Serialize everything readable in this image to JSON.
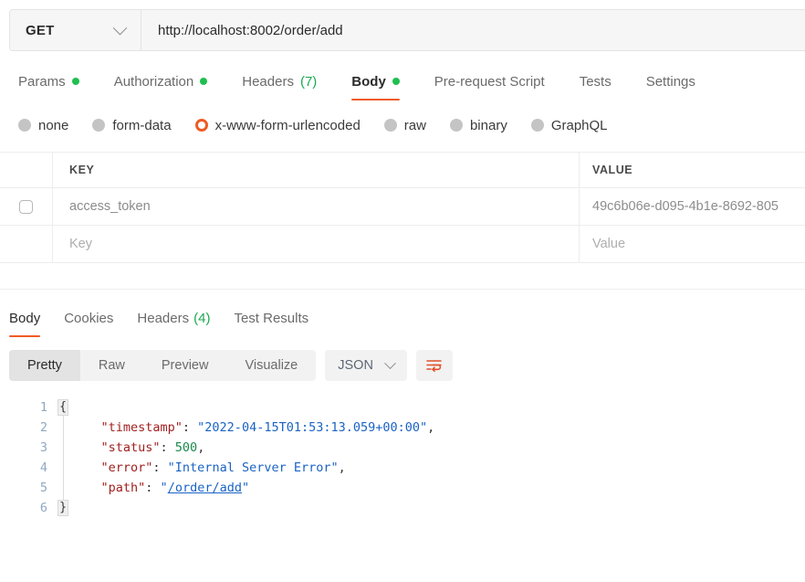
{
  "request": {
    "method": "GET",
    "url": "http://localhost:8002/order/add",
    "tabs": [
      {
        "label": "Params",
        "dot": true,
        "count": "",
        "active": false
      },
      {
        "label": "Authorization",
        "dot": true,
        "count": "",
        "active": false
      },
      {
        "label": "Headers",
        "dot": false,
        "count": "(7)",
        "active": false
      },
      {
        "label": "Body",
        "dot": true,
        "count": "",
        "active": true
      },
      {
        "label": "Pre-request Script",
        "dot": false,
        "count": "",
        "active": false
      },
      {
        "label": "Tests",
        "dot": false,
        "count": "",
        "active": false
      },
      {
        "label": "Settings",
        "dot": false,
        "count": "",
        "active": false
      }
    ],
    "body_types": [
      {
        "label": "none",
        "selected": false
      },
      {
        "label": "form-data",
        "selected": false
      },
      {
        "label": "x-www-form-urlencoded",
        "selected": true
      },
      {
        "label": "raw",
        "selected": false
      },
      {
        "label": "binary",
        "selected": false
      },
      {
        "label": "GraphQL",
        "selected": false
      }
    ],
    "table": {
      "headers": {
        "key": "KEY",
        "value": "VALUE"
      },
      "rows": [
        {
          "checked": false,
          "show_checkbox": true,
          "key": "access_token",
          "value": "49c6b06e-d095-4b1e-8692-805",
          "placeholder": false
        },
        {
          "checked": false,
          "show_checkbox": false,
          "key": "Key",
          "value": "Value",
          "placeholder": true
        }
      ]
    }
  },
  "response": {
    "tabs": [
      {
        "label": "Body",
        "count": "",
        "active": true
      },
      {
        "label": "Cookies",
        "count": "",
        "active": false
      },
      {
        "label": "Headers",
        "count": "(4)",
        "active": false
      },
      {
        "label": "Test Results",
        "count": "",
        "active": false
      }
    ],
    "view_modes": [
      {
        "label": "Pretty",
        "active": true
      },
      {
        "label": "Raw",
        "active": false
      },
      {
        "label": "Preview",
        "active": false
      },
      {
        "label": "Visualize",
        "active": false
      }
    ],
    "format": "JSON",
    "wrap_icon": "wrap-text-icon",
    "code_lines": [
      {
        "num": "1",
        "fold": "{",
        "indent": false,
        "tokens": []
      },
      {
        "num": "2",
        "fold": "",
        "indent": true,
        "tokens": [
          {
            "t": "\"timestamp\"",
            "c": "k"
          },
          {
            "t": ": ",
            "c": "p"
          },
          {
            "t": "\"2022-04-15T01:53:13.059+00:00\"",
            "c": "s"
          },
          {
            "t": ",",
            "c": "p"
          }
        ]
      },
      {
        "num": "3",
        "fold": "",
        "indent": true,
        "tokens": [
          {
            "t": "\"status\"",
            "c": "k"
          },
          {
            "t": ": ",
            "c": "p"
          },
          {
            "t": "500",
            "c": "n"
          },
          {
            "t": ",",
            "c": "p"
          }
        ]
      },
      {
        "num": "4",
        "fold": "",
        "indent": true,
        "tokens": [
          {
            "t": "\"error\"",
            "c": "k"
          },
          {
            "t": ": ",
            "c": "p"
          },
          {
            "t": "\"Internal Server Error\"",
            "c": "s"
          },
          {
            "t": ",",
            "c": "p"
          }
        ]
      },
      {
        "num": "5",
        "fold": "",
        "indent": true,
        "tokens": [
          {
            "t": "\"path\"",
            "c": "k"
          },
          {
            "t": ": ",
            "c": "p"
          },
          {
            "t": "\"",
            "c": "s"
          },
          {
            "t": "/order/add",
            "c": "lnk"
          },
          {
            "t": "\"",
            "c": "s"
          }
        ]
      },
      {
        "num": "6",
        "fold": "}",
        "indent": false,
        "tokens": []
      }
    ]
  },
  "colors": {
    "accent_orange": "#ef5b25",
    "dot_green": "#20bf4f",
    "count_green": "#1aaa52",
    "json_key": "#a11f1f",
    "json_string": "#1a63c4",
    "json_number": "#1a8a4a",
    "toolbar_bg": "#f2f2f2"
  }
}
